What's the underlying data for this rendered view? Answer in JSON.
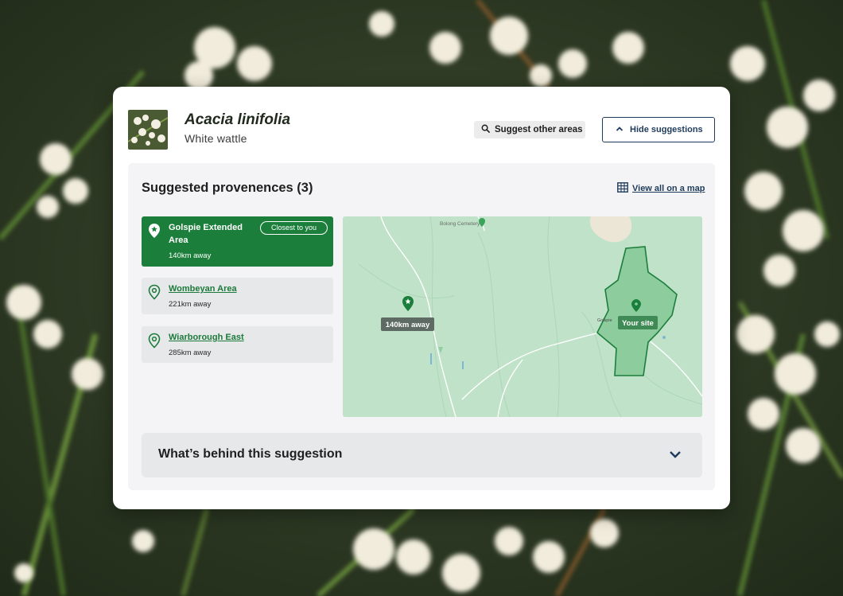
{
  "header": {
    "species_name": "Acacia linifolia",
    "common_name": "White wattle",
    "suggest_other_label": "Suggest other areas",
    "hide_suggestions_label": "Hide suggestions"
  },
  "panel": {
    "title": "Suggested provenences (3)",
    "view_map_label": "View all on a map"
  },
  "provenances": [
    {
      "name": "Golspie Extended Area",
      "distance": "140km away",
      "badge": "Closest to you",
      "selected": true
    },
    {
      "name": "Wombeyan Area",
      "distance": "221km away"
    },
    {
      "name": "Wiarborough East",
      "distance": "285km away"
    }
  ],
  "map": {
    "place_labels": [
      "Bolong Cemetery",
      "Golspie"
    ],
    "marker_distance_label": "140km away",
    "site_label": "Your site"
  },
  "accordion": {
    "label": "What’s behind this suggestion"
  },
  "colors": {
    "primary_green": "#1b7f3b",
    "link_green": "#1c7a3a",
    "navy": "#1f3b5a",
    "map_green": "#bfe2c8"
  },
  "icons": [
    "search-icon",
    "chevron-up-icon",
    "map-grid-icon",
    "star-pin-icon",
    "location-pin-icon",
    "chevron-down-icon"
  ]
}
